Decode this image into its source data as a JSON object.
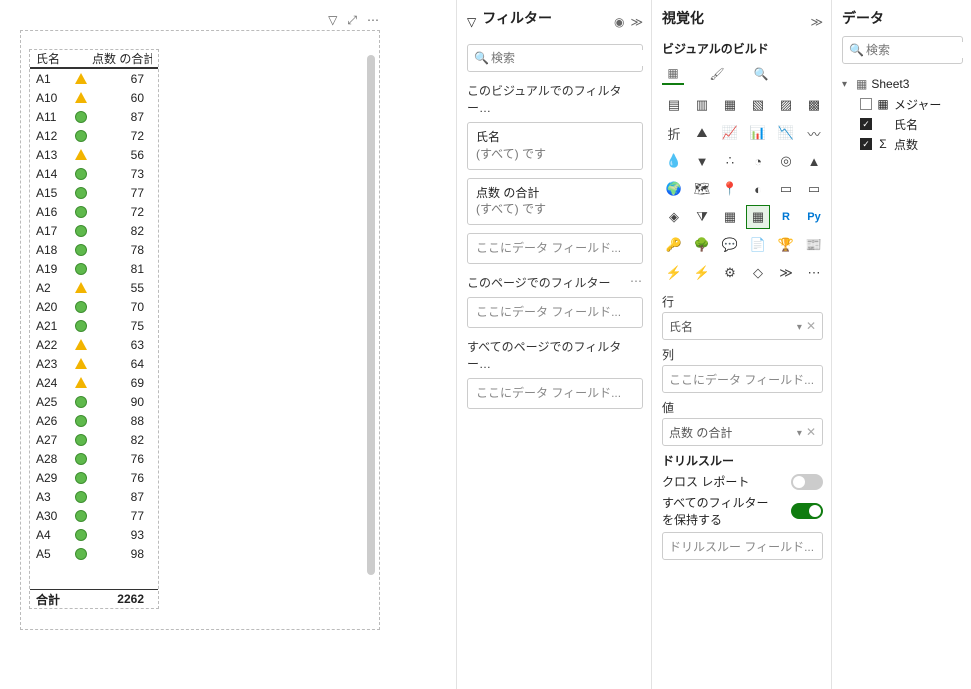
{
  "visual_chrome": {
    "funnel": "⧩",
    "focus": "⤢",
    "more": "⋯"
  },
  "table": {
    "headers": {
      "name": "氏名",
      "score": "点数 の合計"
    },
    "rows": [
      {
        "name": "A1",
        "ind": "tri",
        "val": 67
      },
      {
        "name": "A10",
        "ind": "tri",
        "val": 60
      },
      {
        "name": "A11",
        "ind": "cir",
        "val": 87
      },
      {
        "name": "A12",
        "ind": "cir",
        "val": 72
      },
      {
        "name": "A13",
        "ind": "tri",
        "val": 56
      },
      {
        "name": "A14",
        "ind": "cir",
        "val": 73
      },
      {
        "name": "A15",
        "ind": "cir",
        "val": 77
      },
      {
        "name": "A16",
        "ind": "cir",
        "val": 72
      },
      {
        "name": "A17",
        "ind": "cir",
        "val": 82
      },
      {
        "name": "A18",
        "ind": "cir",
        "val": 78
      },
      {
        "name": "A19",
        "ind": "cir",
        "val": 81
      },
      {
        "name": "A2",
        "ind": "tri",
        "val": 55
      },
      {
        "name": "A20",
        "ind": "cir",
        "val": 70
      },
      {
        "name": "A21",
        "ind": "cir",
        "val": 75
      },
      {
        "name": "A22",
        "ind": "tri",
        "val": 63
      },
      {
        "name": "A23",
        "ind": "tri",
        "val": 64
      },
      {
        "name": "A24",
        "ind": "tri",
        "val": 69
      },
      {
        "name": "A25",
        "ind": "cir",
        "val": 90
      },
      {
        "name": "A26",
        "ind": "cir",
        "val": 88
      },
      {
        "name": "A27",
        "ind": "cir",
        "val": 82
      },
      {
        "name": "A28",
        "ind": "cir",
        "val": 76
      },
      {
        "name": "A29",
        "ind": "cir",
        "val": 76
      },
      {
        "name": "A3",
        "ind": "cir",
        "val": 87
      },
      {
        "name": "A30",
        "ind": "cir",
        "val": 77
      },
      {
        "name": "A4",
        "ind": "cir",
        "val": 93
      },
      {
        "name": "A5",
        "ind": "cir",
        "val": 98
      }
    ],
    "total": {
      "label": "合計",
      "value": 2262
    }
  },
  "filters": {
    "title": "フィルター",
    "search_placeholder": "検索",
    "this_visual": "このビジュアルでのフィルター…",
    "card1": {
      "title": "氏名",
      "value": "(すべて) です"
    },
    "card2": {
      "title": "点数 の合計",
      "value": "(すべて) です"
    },
    "this_page": "このページでのフィルター",
    "all_pages": "すべてのページでのフィルター…",
    "drop_here": "ここにデータ フィールド..."
  },
  "viz": {
    "title": "視覚化",
    "subtitle": "ビジュアルのビルド",
    "rows_label": "行",
    "rows_value": "氏名",
    "cols_label": "列",
    "cols_placeholder": "ここにデータ フィールド...",
    "values_label": "値",
    "values_value": "点数 の合計",
    "drill_title": "ドリルスルー",
    "cross_report": "クロス レポート",
    "keep_filters": "すべてのフィルターを保持する",
    "drill_placeholder": "ドリルスルー フィールド...",
    "icons": [
      "stacked-bar",
      "stacked-column",
      "clustered-bar",
      "clustered-column",
      "100-bar",
      "100-column",
      "line",
      "area",
      "stacked-area",
      "line-column",
      "line-column2",
      "ribbon",
      "waterfall",
      "funnel",
      "scatter",
      "pie",
      "donut",
      "treemap",
      "map",
      "filled-map",
      "azure-map",
      "gauge",
      "card",
      "multi-card",
      "kpi",
      "slicer",
      "table",
      "matrix",
      "r",
      "py",
      "key-influencers",
      "decomposition",
      "qa",
      "narrative",
      "goals",
      "paginated",
      "power-apps",
      "power-automate",
      "ai",
      "apps",
      "more",
      "ellipsis"
    ],
    "selected_icon_index": 27
  },
  "data_pane": {
    "title": "データ",
    "search_placeholder": "検索",
    "table_name": "Sheet3",
    "fields": [
      {
        "checked": false,
        "icon": "measure",
        "label": "メジャー"
      },
      {
        "checked": true,
        "icon": "",
        "label": "氏名"
      },
      {
        "checked": true,
        "icon": "sigma",
        "label": "点数"
      }
    ]
  }
}
